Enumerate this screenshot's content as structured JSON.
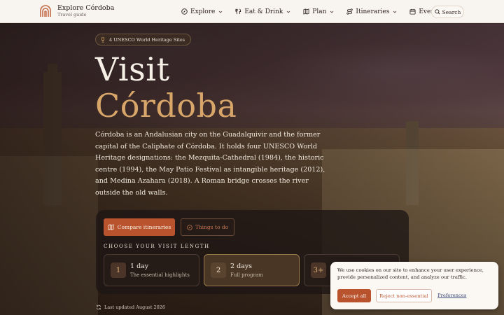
{
  "header": {
    "brand_title": "Explore Córdoba",
    "brand_subtitle": "Travel guide",
    "nav": [
      {
        "label": "Explore",
        "icon": "compass-icon"
      },
      {
        "label": "Eat & Drink",
        "icon": "fork-knife-icon"
      },
      {
        "label": "Plan",
        "icon": "map-icon"
      },
      {
        "label": "Itineraries",
        "icon": "route-icon"
      },
      {
        "label": "Events",
        "icon": "calendar-icon"
      }
    ],
    "search_label": "Search"
  },
  "hero": {
    "badge": "4 UNESCO World Heritage Sites",
    "title_line1": "Visit",
    "title_line2": "Córdoba",
    "intro": "Córdoba is an Andalusian city on the Guadalquivir and the former capital of the Caliphate of Córdoba. It holds four UNESCO World Heritage designations: the Mezquita-Cathedral (1984), the historic centre (1994), the May Patio Festival as intangible heritage (2012), and Medina Azahara (2018). A Roman bridge crosses the river outside the old walls."
  },
  "actions": {
    "primary": "Compare itineraries",
    "secondary": "Things to do"
  },
  "visit_length": {
    "label": "CHOOSE YOUR VISIT LENGTH",
    "options": [
      {
        "num": "1",
        "title": "1 day",
        "subtitle": "The essential highlights"
      },
      {
        "num": "2",
        "title": "2 days",
        "subtitle": "Full program"
      },
      {
        "num": "3+",
        "title": "",
        "subtitle": ""
      }
    ],
    "selected_index": 1
  },
  "updated": "Last updated August 2026",
  "cookie": {
    "text": "We use cookies on our site to enhance your user experience, provide personalized content, and analyze our traffic.",
    "accept": "Accept all",
    "reject": "Reject non-essential",
    "preferences": "Preferences"
  },
  "colors": {
    "accent": "#b9532d",
    "gold": "#d9a66a",
    "header_bg": "#f8f4ef"
  }
}
